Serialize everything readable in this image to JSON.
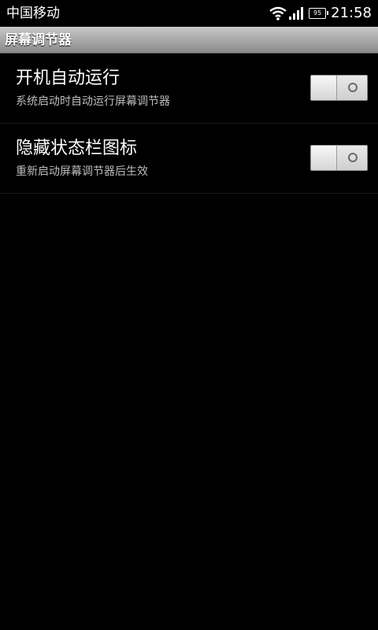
{
  "status_bar": {
    "carrier": "中国移动",
    "battery_level": "95",
    "time": "21:58"
  },
  "title_bar": {
    "title": "屏幕调节器"
  },
  "settings": [
    {
      "title": "开机自动运行",
      "description": "系统启动时自动运行屏幕调节器",
      "enabled": false
    },
    {
      "title": "隐藏状态栏图标",
      "description": "重新启动屏幕调节器后生效",
      "enabled": false
    }
  ],
  "colors": {
    "background": "#000000",
    "title_bar_top": "#c8c8c8",
    "title_bar_bottom": "#8a8a8a",
    "primary_text": "#ffffff",
    "secondary_text": "#bdbdbd"
  }
}
